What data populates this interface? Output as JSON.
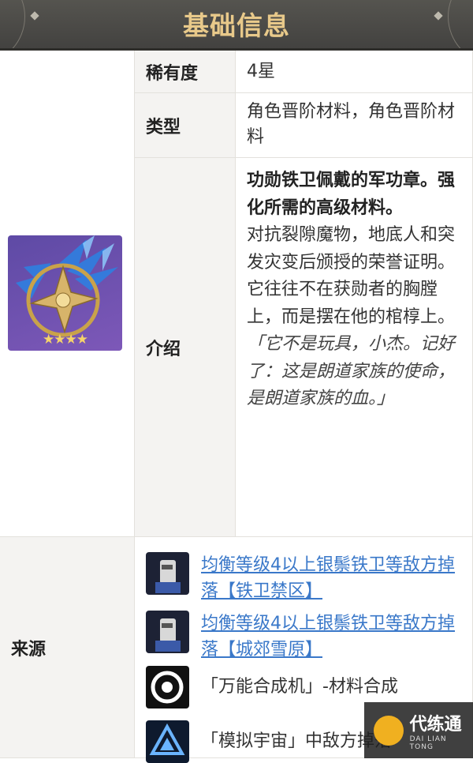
{
  "header": {
    "title": "基础信息"
  },
  "rows": {
    "rarity": {
      "label": "稀有度",
      "value": "4星"
    },
    "type": {
      "label": "类型",
      "value": "角色晋阶材料，角色晋阶材料"
    },
    "intro": {
      "label": "介绍",
      "bold": "功勋铁卫佩戴的军功章。强化所需的高级材料。",
      "p1": "对抗裂隙魔物，地底人和突发灾变后颁授的荣誉证明。",
      "p2": "它往往不在获勋者的胸膛上，而是摆在他的棺椁上。",
      "quote": "「它不是玩具，小杰。记好了：这是朗道家族的使命，是朗道家族的血。」"
    },
    "source": {
      "label": "来源",
      "items": [
        {
          "text": "均衡等级4以上银鬃铁卫等敌方掉落【铁卫禁区】",
          "icon": "enemy-icon"
        },
        {
          "text": "均衡等级4以上银鬃铁卫等敌方掉落【城郊雪原】",
          "icon": "enemy-icon"
        },
        {
          "text": "「万能合成机」-材料合成",
          "icon": "synthesizer-icon"
        },
        {
          "text": "「模拟宇宙」中敌方掉落",
          "icon": "universe-icon"
        }
      ]
    }
  },
  "item": {
    "stars": "★★★★",
    "icon": "medal-icon"
  },
  "watermark": {
    "name": "代练通",
    "sub": "DAI LIAN TONG"
  }
}
